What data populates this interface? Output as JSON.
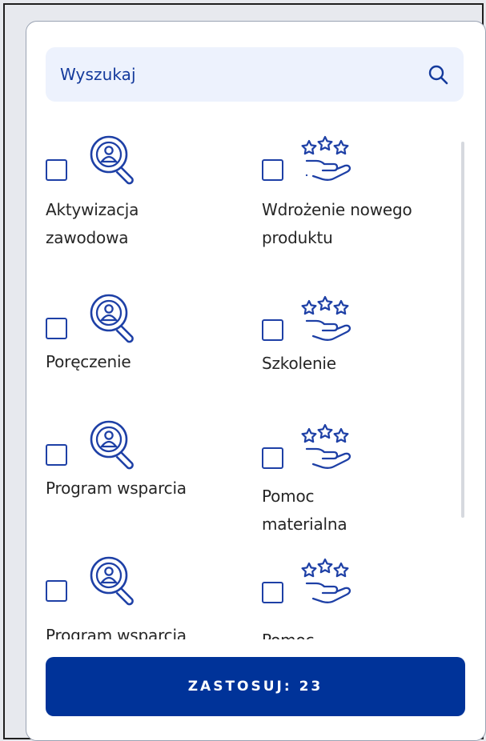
{
  "search": {
    "placeholder": "Wyszukaj"
  },
  "items": [
    {
      "label": "Aktywizacja zawodowa",
      "icon": "search-person-icon"
    },
    {
      "label": "Wdrożenie nowego produktu",
      "icon": "stars-hand-icon"
    },
    {
      "label": "Poręczenie",
      "icon": "search-person-icon"
    },
    {
      "label": "Szkolenie",
      "icon": "stars-hand-icon"
    },
    {
      "label": "Program wsparcia",
      "icon": "search-person-icon"
    },
    {
      "label": "Pomoc materialna",
      "icon": "stars-hand-icon"
    },
    {
      "label": "Program wsparcia",
      "icon": "search-person-icon"
    },
    {
      "label": "Pomoc materialna",
      "icon": "stars-hand-icon"
    }
  ],
  "apply_button": {
    "label": "ZASTOSUJ: 23"
  },
  "colors": {
    "accent": "#003399",
    "search_bg": "#edf2fd",
    "icon": "#1e40a6"
  }
}
